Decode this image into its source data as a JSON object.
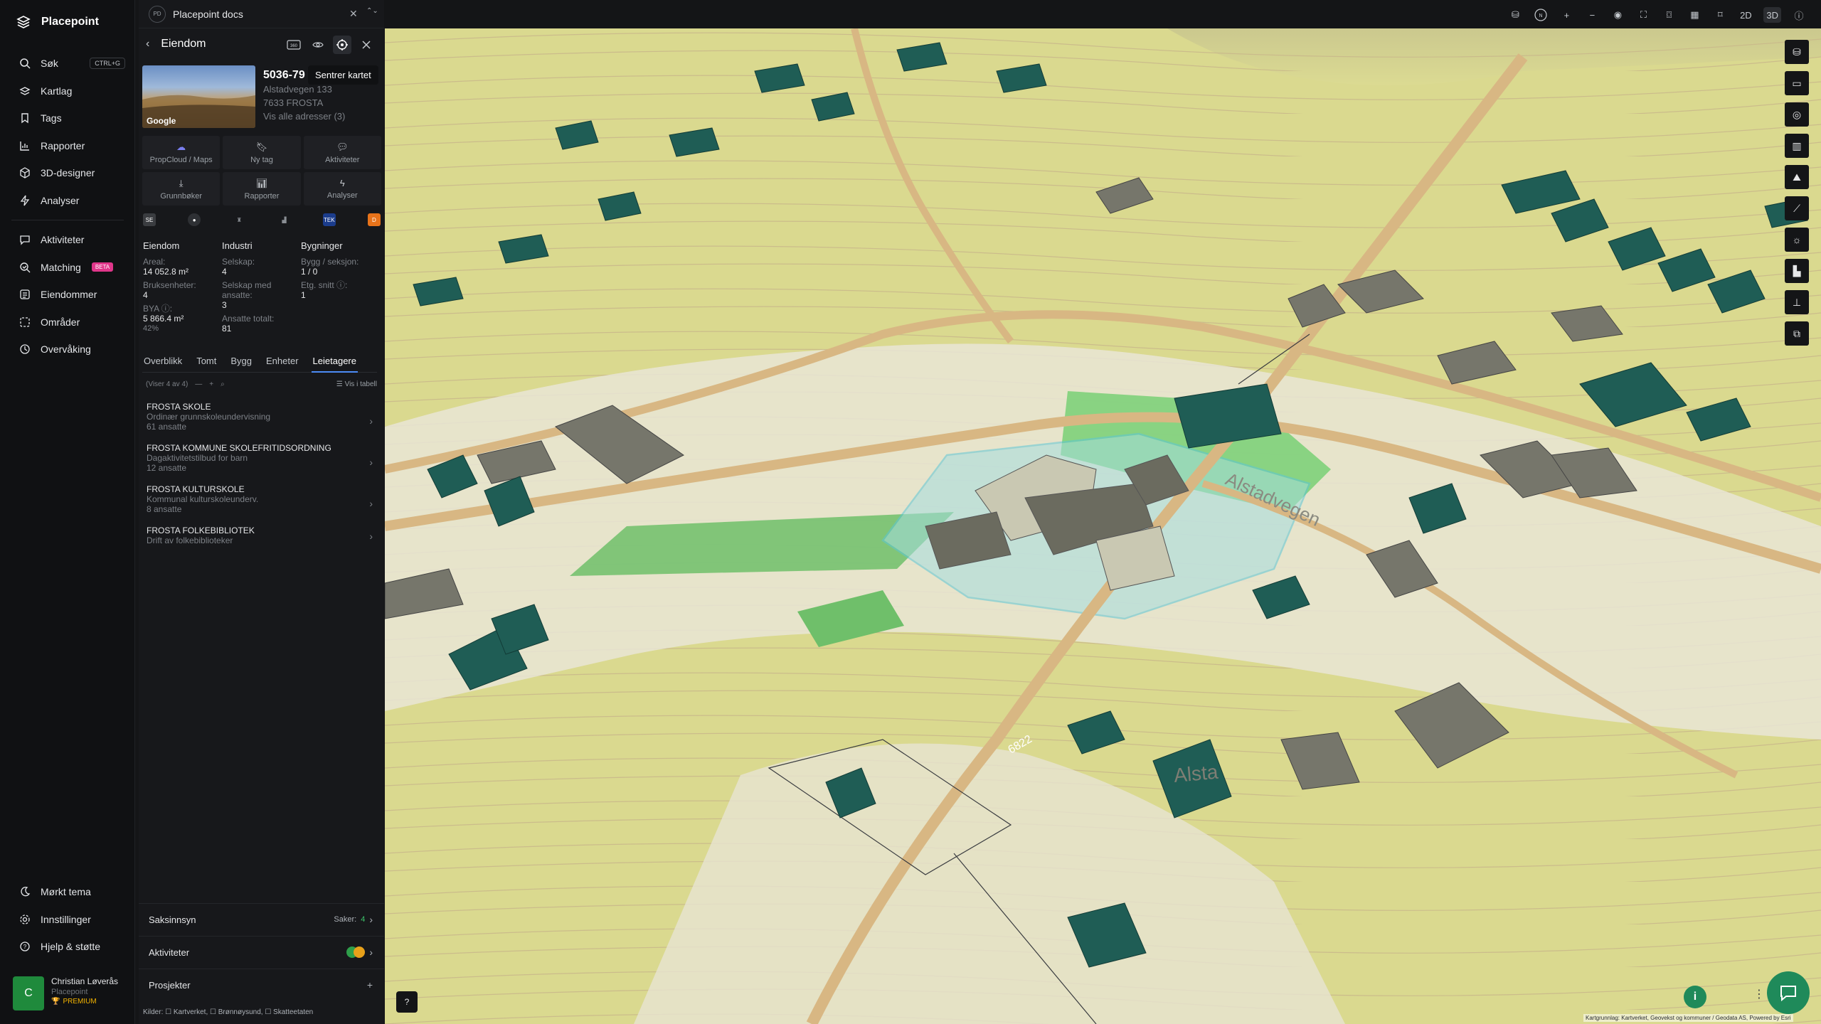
{
  "nav": {
    "brand": "Placepoint",
    "items": [
      {
        "label": "Søk",
        "icon": "search-icon",
        "shortcut": "CTRL+G"
      },
      {
        "label": "Kartlag",
        "icon": "layers-icon"
      },
      {
        "label": "Tags",
        "icon": "bookmark-icon"
      },
      {
        "label": "Rapporter",
        "icon": "chart-icon"
      },
      {
        "label": "3D-designer",
        "icon": "cube-icon"
      },
      {
        "label": "Analyser",
        "icon": "bolt-icon"
      }
    ],
    "items2": [
      {
        "label": "Aktiviteter",
        "icon": "chat-icon"
      },
      {
        "label": "Matching",
        "icon": "match-icon",
        "badge": "BETA"
      },
      {
        "label": "Eiendommer",
        "icon": "list-icon"
      },
      {
        "label": "Områder",
        "icon": "area-icon"
      },
      {
        "label": "Overvåking",
        "icon": "clock-icon"
      }
    ],
    "bottom": [
      {
        "label": "Mørkt tema",
        "icon": "moon-icon"
      },
      {
        "label": "Innstillinger",
        "icon": "gear-icon"
      },
      {
        "label": "Hjelp & støtte",
        "icon": "help-icon"
      }
    ],
    "user": {
      "initial": "C",
      "name": "Christian Løverås",
      "org": "Placepoint",
      "plan": "PREMIUM"
    }
  },
  "panel": {
    "docs_logo": "PD",
    "docs_title": "Placepoint docs",
    "header_title": "Eiendom",
    "tooltip": "Sentrer kartet",
    "photo_label": "Google",
    "property": {
      "id": "5036-79",
      "address": "Alstadvegen 133",
      "postal": "7633 FROSTA",
      "all_addresses": "Vis alle adresser (3)"
    },
    "actions": [
      {
        "label": "PropCloud / Maps",
        "icon": "cloud-icon"
      },
      {
        "label": "Ny tag",
        "icon": "bookmark-icon"
      },
      {
        "label": "Aktiviteter",
        "icon": "chat-icon"
      },
      {
        "label": "Grunnbøker",
        "icon": "download-icon"
      },
      {
        "label": "Rapporter",
        "icon": "chart-icon"
      },
      {
        "label": "Analyser",
        "icon": "bolt-icon"
      }
    ],
    "logos": [
      "SE",
      "●",
      "♜",
      "▟",
      "TEK",
      "D"
    ],
    "stats": {
      "eiendom": {
        "heading": "Eiendom",
        "areal_label": "Areal:",
        "areal": "14 052.8 m²",
        "bruks_label": "Bruksenheter:",
        "bruks": "4",
        "bya_label": "BYA ⓘ:",
        "bya": "5 866.4 m²",
        "bya_pct": "42%"
      },
      "industri": {
        "heading": "Industri",
        "selskap_label": "Selskap:",
        "selskap": "4",
        "med_ansatte_label": "Selskap med ansatte:",
        "med_ansatte": "3",
        "ansatte_label": "Ansatte totalt:",
        "ansatte": "81"
      },
      "bygninger": {
        "heading": "Bygninger",
        "bygg_label": "Bygg / seksjon:",
        "bygg": "1 / 0",
        "etg_label": "Etg. snitt ⓘ:",
        "etg": "1"
      }
    },
    "tabs": [
      "Overblikk",
      "Tomt",
      "Bygg",
      "Enheter",
      "Leietagere"
    ],
    "list_count": "(Viser 4 av 4)",
    "table_link": "Vis i tabell",
    "tenants": [
      {
        "name": "FROSTA SKOLE",
        "desc": "Ordinær grunnskoleundervisning",
        "emp": "61 ansatte"
      },
      {
        "name": "FROSTA KOMMUNE SKOLEFRITIDSORDNING",
        "desc": "Dagaktivitetstilbud for barn",
        "emp": "12 ansatte"
      },
      {
        "name": "FROSTA KULTURSKOLE",
        "desc": "Kommunal kulturskoleunderv.",
        "emp": "8 ansatte"
      },
      {
        "name": "FROSTA FOLKEBIBLIOTEK",
        "desc": "Drift av folkebiblioteker",
        "emp": ""
      }
    ],
    "sections": [
      {
        "label": "Saksinnsyn",
        "right_label": "Saker:",
        "right_value": "4"
      },
      {
        "label": "Aktiviteter"
      },
      {
        "label": "Prosjekter"
      }
    ],
    "sources": "Kilder: ☐ Kartverket, ☐ Brønnøysund, ☐ Skatteetaten"
  },
  "map": {
    "view_2d": "2D",
    "view_3d": "3D",
    "road_labels": [
      "Alstadvegen",
      "Alsta",
      "6822"
    ],
    "attribution": "Kartgrunnlag: Kartverket, Geovekst og kommuner / Geodata AS, Powered by Esri",
    "help": "?",
    "info": "i",
    "colors": {
      "terrain": "#d9d88f",
      "building": "#1f5d55",
      "school": "#c9c8b2",
      "road": "#d9b986",
      "accent": "#1f8a5a"
    }
  }
}
